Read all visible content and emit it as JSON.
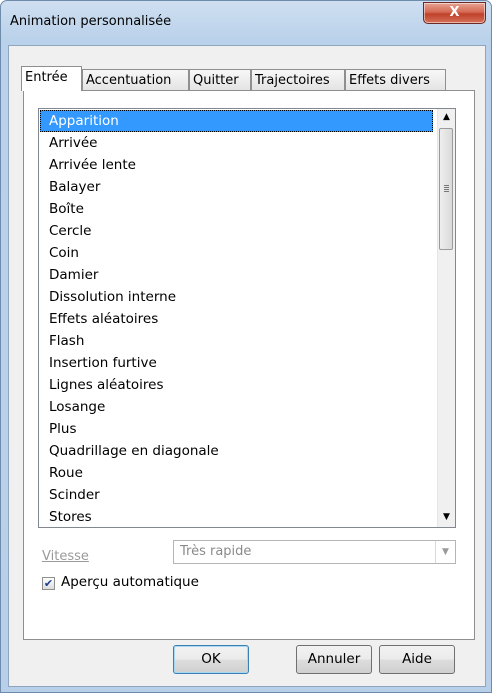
{
  "window": {
    "title": "Animation personnalisée",
    "close_glyph": "X"
  },
  "tabs": [
    {
      "label": "Entrée",
      "active": true
    },
    {
      "label": "Accentuation",
      "active": false
    },
    {
      "label": "Quitter",
      "active": false
    },
    {
      "label": "Trajectoires",
      "active": false
    },
    {
      "label": "Effets divers",
      "active": false
    }
  ],
  "effects_list": {
    "selected": "Apparition",
    "items": [
      "Apparition",
      "Arrivée",
      "Arrivée lente",
      "Balayer",
      "Boîte",
      "Cercle",
      "Coin",
      "Damier",
      "Dissolution interne",
      "Effets aléatoires",
      "Flash",
      "Insertion furtive",
      "Lignes aléatoires",
      "Losange",
      "Plus",
      "Quadrillage en diagonale",
      "Roue",
      "Scinder",
      "Stores"
    ]
  },
  "speed": {
    "label": "Vitesse",
    "value": "Très rapide",
    "enabled": false
  },
  "auto_preview": {
    "label": "Aperçu automatique",
    "checked": true
  },
  "buttons": {
    "ok": "OK",
    "cancel": "Annuler",
    "help": "Aide"
  },
  "icons": {
    "close": "close-icon",
    "scroll_up": "arrow-up-icon",
    "scroll_down": "arrow-down-icon",
    "combo_arrow": "chevron-down-icon",
    "check": "checkmark-icon"
  }
}
